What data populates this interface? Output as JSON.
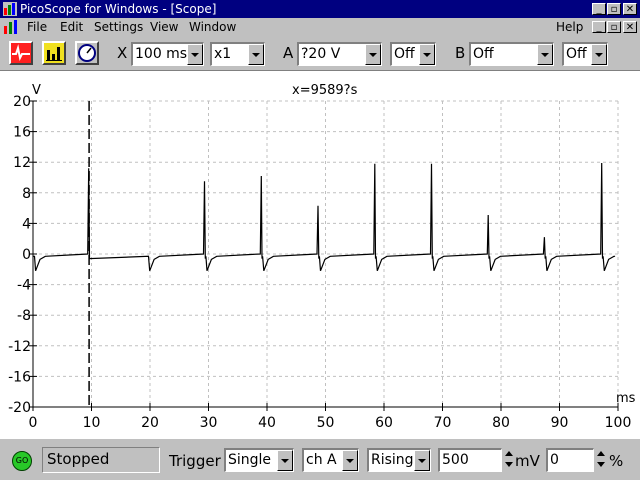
{
  "window": {
    "title": "PicoScope for Windows - [Scope]",
    "controls": [
      "_",
      "▫",
      "✕"
    ]
  },
  "menu": {
    "items": [
      "File",
      "Edit",
      "Settings",
      "View",
      "Window"
    ],
    "help": "Help",
    "doc_controls": [
      "_",
      "▫",
      "✕"
    ]
  },
  "toolbar": {
    "x_label": "X",
    "timebase": "100 ms",
    "multiplier": "x1",
    "a_label": "A",
    "channel_a_range": "?20 V",
    "channel_a_coupling": "Off",
    "b_label": "B",
    "channel_b_range": "Off",
    "channel_b_coupling": "Off"
  },
  "scope": {
    "cursor_readout": "x=9589?s",
    "y_unit": "V",
    "x_unit": "ms",
    "y_ticks": [
      "20",
      "16",
      "12",
      "8",
      "4",
      "0",
      "-4",
      "-8",
      "-12",
      "-16",
      "-20"
    ],
    "x_ticks": [
      "0",
      "10",
      "20",
      "30",
      "40",
      "50",
      "60",
      "70",
      "80",
      "90",
      "100"
    ]
  },
  "chart_data": {
    "type": "line",
    "title": "",
    "xlabel": "ms",
    "ylabel": "V",
    "xlim": [
      0,
      100
    ],
    "ylim": [
      -20,
      20
    ],
    "grid": true,
    "cursor_x": 9.589,
    "series": [
      {
        "baseline": -0.3,
        "spikes": [
          {
            "x": 9.6,
            "y": 11.2
          },
          {
            "x": 29.4,
            "y": 9.5
          },
          {
            "x": 39.1,
            "y": 10.2
          },
          {
            "x": 48.8,
            "y": 6.3
          },
          {
            "x": 58.5,
            "y": 11.8
          },
          {
            "x": 68.2,
            "y": 11.8
          },
          {
            "x": 77.9,
            "y": 5.1
          },
          {
            "x": 87.5,
            "y": 2.2
          },
          {
            "x": 97.3,
            "y": 11.9
          }
        ],
        "dips": [
          0.3,
          19.8,
          29.6,
          39.3,
          49.0,
          58.7,
          68.4,
          78.1,
          87.7,
          97.5
        ],
        "dip_value": -2.2
      }
    ]
  },
  "status": {
    "go_label": "GO",
    "state": "Stopped",
    "trigger_label": "Trigger",
    "trigger_mode": "Single",
    "trigger_channel": "ch A",
    "trigger_edge": "Rising",
    "trigger_level": "500",
    "level_unit": "mV",
    "pretrigger": "0",
    "pretrigger_unit": "%"
  },
  "colors": {
    "titlebar": "#000080",
    "grid": "#c0c0c0",
    "trace": "#000000",
    "face": "#c0c0c0"
  }
}
